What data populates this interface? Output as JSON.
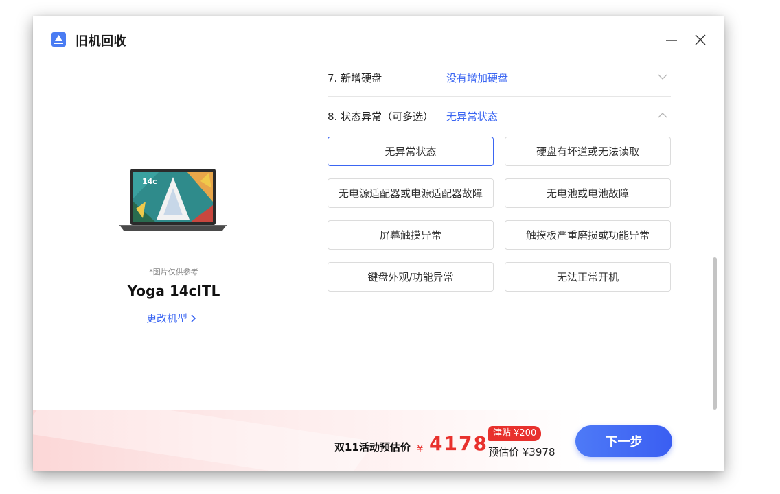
{
  "app": {
    "title": "旧机回收"
  },
  "device": {
    "image_note": "*图片仅供参考",
    "model_name": "Yoga 14cITL",
    "screen_text": "14c",
    "change_model_label": "更改机型"
  },
  "questions": [
    {
      "label": "7. 新增硬盘",
      "value": "没有增加硬盘",
      "expanded": false
    },
    {
      "label": "8. 状态异常（可多选）",
      "value": "无异常状态",
      "expanded": true
    }
  ],
  "options": [
    {
      "label": "无异常状态",
      "selected": true
    },
    {
      "label": "硬盘有坏道或无法读取",
      "selected": false
    },
    {
      "label": "无电源适配器或电源适配器故障",
      "selected": false
    },
    {
      "label": "无电池或电池故障",
      "selected": false
    },
    {
      "label": "屏幕触摸异常",
      "selected": false
    },
    {
      "label": "触摸板严重磨损或功能异常",
      "selected": false
    },
    {
      "label": "键盘外观/功能异常",
      "selected": false
    },
    {
      "label": "无法正常开机",
      "selected": false
    }
  ],
  "footer": {
    "promo_label": "双11活动预估价",
    "currency": "¥",
    "promo_price": "4178",
    "subsidy": "津贴 ¥200",
    "base_price": "预估价 ¥3978",
    "next_label": "下一步"
  },
  "colors": {
    "accent": "#3b66f2",
    "price_red": "#e8312d"
  }
}
